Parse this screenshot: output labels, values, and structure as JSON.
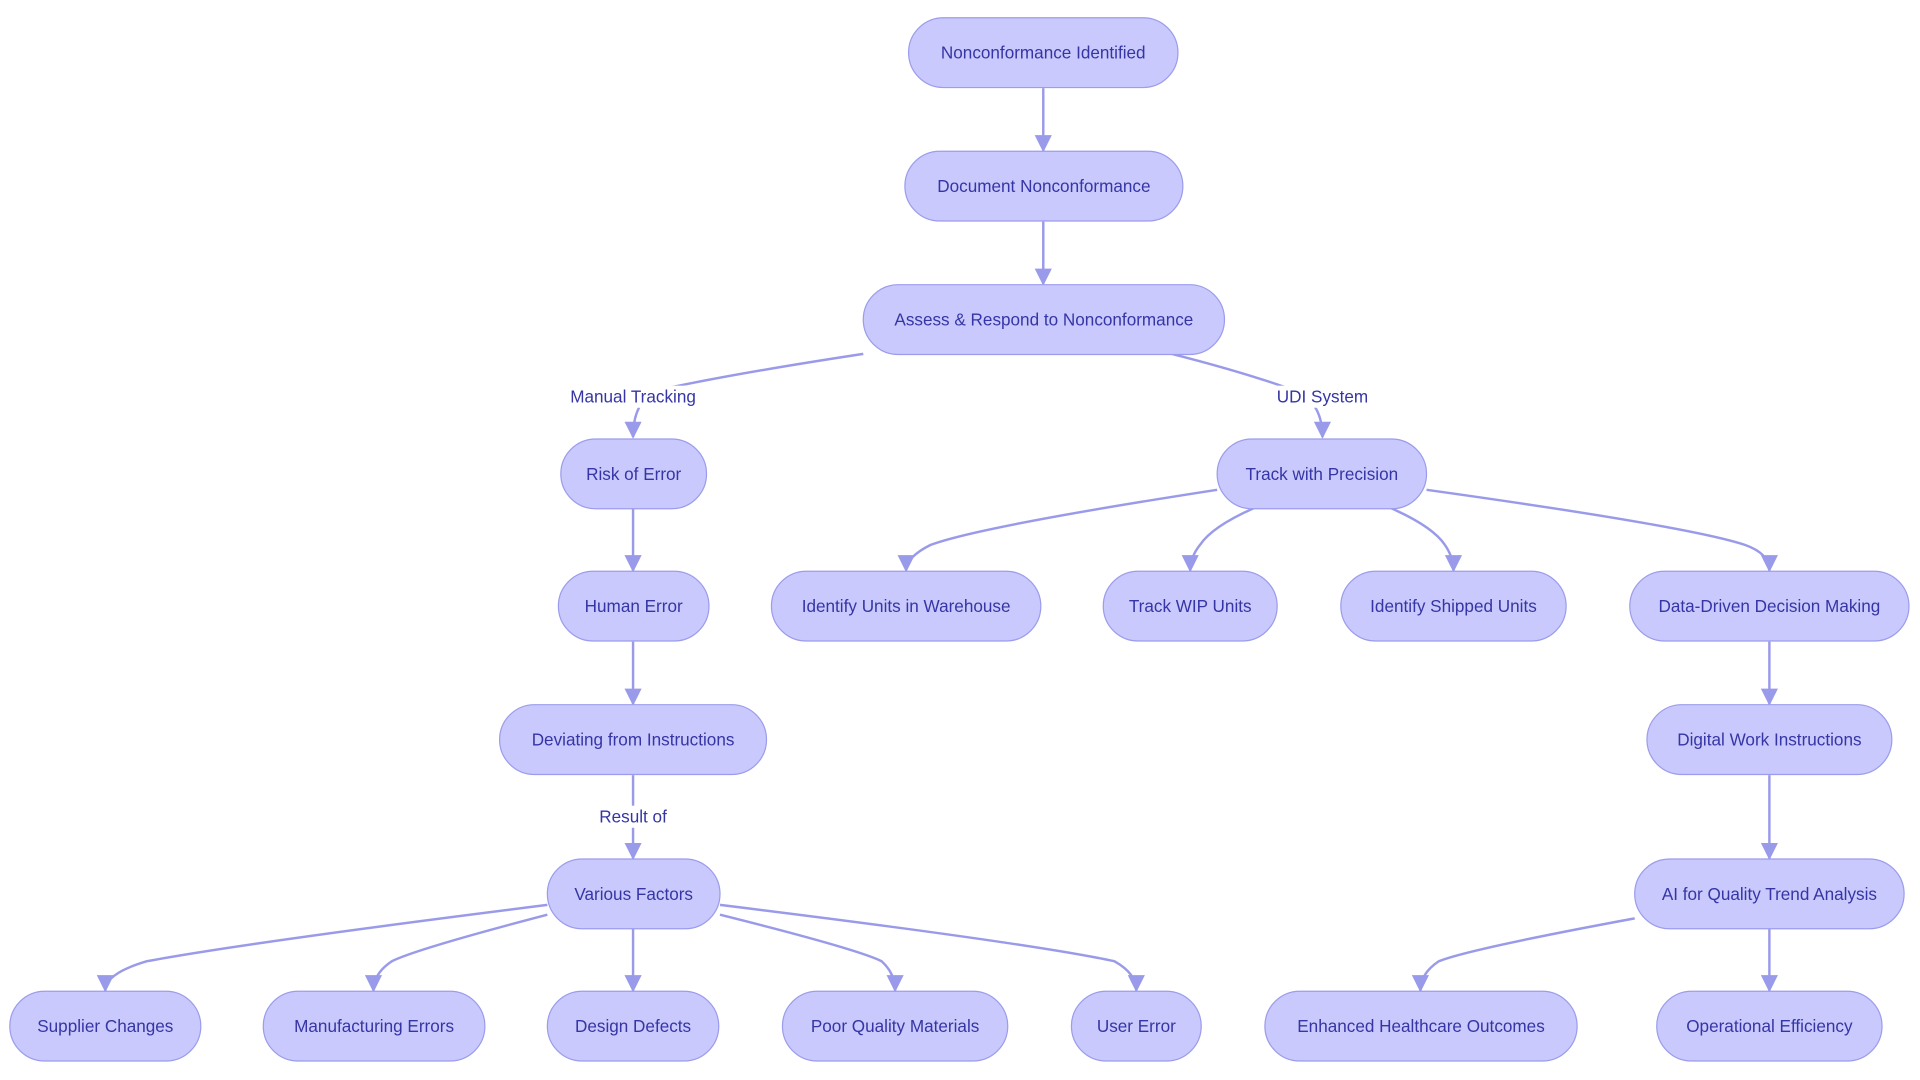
{
  "colors": {
    "node_fill": "#c9c9fd",
    "node_stroke": "#9c9cec",
    "text": "#3535a5",
    "edge": "#9a9aea"
  },
  "nodes": {
    "n1": "Nonconformance Identified",
    "n2": "Document Nonconformance",
    "n3": "Assess & Respond to Nonconformance",
    "n4": "Risk of Error",
    "n5": "Human Error",
    "n6": "Deviating from Instructions",
    "n7": "Various Factors",
    "n8": "Supplier Changes",
    "n9": "Manufacturing Errors",
    "n10": "Design Defects",
    "n11": "Poor Quality Materials",
    "n12": "User Error",
    "n13": "Track with Precision",
    "n14": "Identify Units in Warehouse",
    "n15": "Track WIP Units",
    "n16": "Identify Shipped Units",
    "n17": "Data-Driven Decision Making",
    "n18": "Digital Work Instructions",
    "n19": "AI for Quality Trend Analysis",
    "n20": "Enhanced Healthcare Outcomes",
    "n21": "Operational Efficiency"
  },
  "edge_labels": {
    "manual": "Manual Tracking",
    "udi": "UDI System",
    "result": "Result of"
  }
}
